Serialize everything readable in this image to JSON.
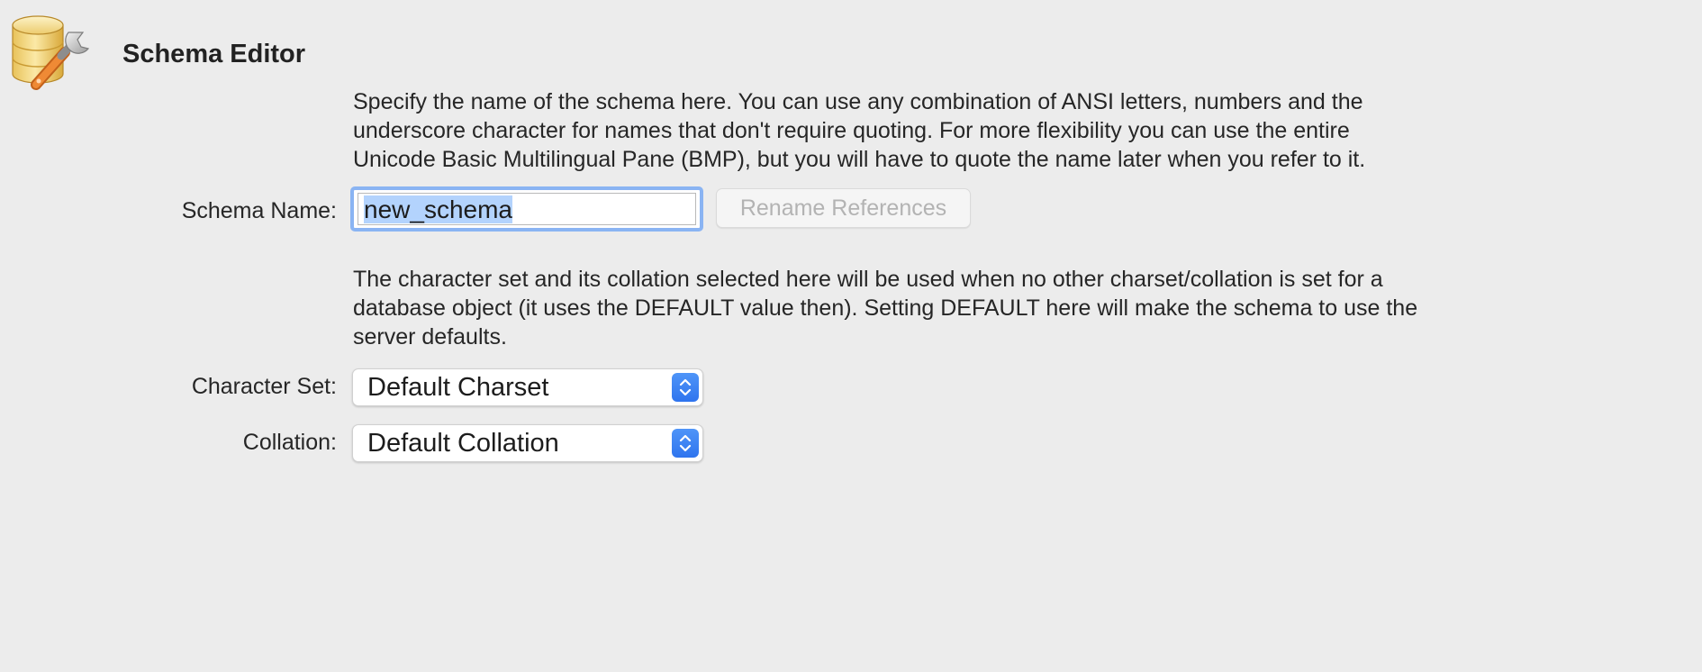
{
  "header": {
    "title": "Schema Editor",
    "icon": "database-wrench-icon"
  },
  "schema_section": {
    "help_lines": [
      "Specify the name of the schema here. You can use any combination of ANSI letters, numbers and the",
      "underscore character for names that don't require quoting. For more flexibility you can use the entire",
      "Unicode Basic Multilingual Pane (BMP), but you will have to quote the name later when you refer to it."
    ],
    "name_label": "Schema Name:",
    "name_value": "new_schema",
    "rename_button_label": "Rename References"
  },
  "charset_section": {
    "help_lines": [
      "The character set and its collation selected here will be used when no other charset/collation is set for a",
      "database object (it uses the DEFAULT value then). Setting DEFAULT here will make the schema to use the",
      "server defaults."
    ],
    "charset_label": "Character Set:",
    "charset_value": "Default Charset",
    "collation_label": "Collation:",
    "collation_value": "Default Collation"
  },
  "colors": {
    "background": "#ececec",
    "focus_ring": "#8ab4f3",
    "selection": "#b3d3fd",
    "stepper_accent": "#2f74ee",
    "disabled_text": "#b3b3b3"
  }
}
